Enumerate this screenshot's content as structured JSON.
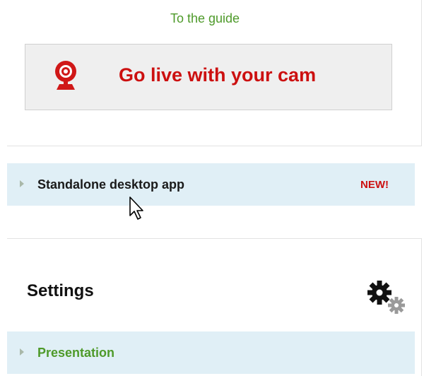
{
  "top_panel": {
    "guide_link": "To the guide",
    "go_live_button": {
      "label": "Go live with your cam",
      "icon": "webcam-icon"
    }
  },
  "desktop_app": {
    "label": "Standalone desktop app",
    "badge": "NEW!",
    "icon": "expand-triangle-icon"
  },
  "settings": {
    "title": "Settings",
    "icon": "gears-icon",
    "items": [
      {
        "label": "Presentation",
        "icon": "expand-triangle-icon"
      }
    ]
  },
  "colors": {
    "link_green": "#4e9a2a",
    "accent_red": "#cc1010",
    "row_blue": "#e0eff6",
    "button_gray": "#efefef"
  }
}
